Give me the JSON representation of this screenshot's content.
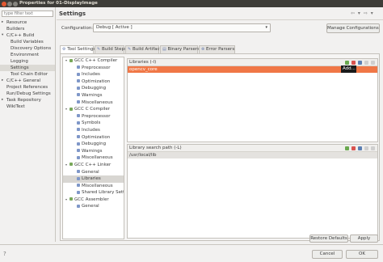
{
  "window": {
    "title": "Properties for 01-DisplayImage"
  },
  "filter": {
    "placeholder": "type filter text"
  },
  "nav": [
    {
      "label": "Resource",
      "arrow": "▸",
      "indent": 0
    },
    {
      "label": "Builders",
      "arrow": "",
      "indent": 0
    },
    {
      "label": "C/C++ Build",
      "arrow": "▾",
      "indent": 0
    },
    {
      "label": "Build Variables",
      "arrow": "",
      "indent": 1
    },
    {
      "label": "Discovery Options",
      "arrow": "",
      "indent": 1
    },
    {
      "label": "Environment",
      "arrow": "",
      "indent": 1
    },
    {
      "label": "Logging",
      "arrow": "",
      "indent": 1
    },
    {
      "label": "Settings",
      "arrow": "",
      "indent": 1,
      "selected": true
    },
    {
      "label": "Tool Chain Editor",
      "arrow": "",
      "indent": 1
    },
    {
      "label": "C/C++ General",
      "arrow": "▸",
      "indent": 0
    },
    {
      "label": "Project References",
      "arrow": "",
      "indent": 0
    },
    {
      "label": "Run/Debug Settings",
      "arrow": "",
      "indent": 0
    },
    {
      "label": "Task Repository",
      "arrow": "▸",
      "indent": 0
    },
    {
      "label": "WikiText",
      "arrow": "",
      "indent": 0
    }
  ],
  "header": {
    "title": "Settings",
    "nav_arrows": "⇦ ▾ ⇨ ▾"
  },
  "configuration": {
    "label": "Configuration:",
    "value": "Debug  [ Active ]",
    "manage_label": "Manage Configurations..."
  },
  "tabs": [
    {
      "label": "Tool Settings",
      "icon": "gear-icon",
      "active": true
    },
    {
      "label": "Build Steps",
      "icon": "build-steps-icon"
    },
    {
      "label": "Build Artifact",
      "icon": "artifact-icon"
    },
    {
      "label": "Binary Parsers",
      "icon": "binary-parser-icon"
    },
    {
      "label": "Error Parsers",
      "icon": "error-parser-icon"
    }
  ],
  "tree": [
    {
      "label": "GCC C++ Compiler",
      "level": 0,
      "arrow": "▾"
    },
    {
      "label": "Preprocessor",
      "level": 1
    },
    {
      "label": "Includes",
      "level": 1
    },
    {
      "label": "Optimization",
      "level": 1
    },
    {
      "label": "Debugging",
      "level": 1
    },
    {
      "label": "Warnings",
      "level": 1
    },
    {
      "label": "Miscellaneous",
      "level": 1
    },
    {
      "label": "GCC C Compiler",
      "level": 0,
      "arrow": "▾"
    },
    {
      "label": "Preprocessor",
      "level": 1
    },
    {
      "label": "Symbols",
      "level": 1
    },
    {
      "label": "Includes",
      "level": 1
    },
    {
      "label": "Optimization",
      "level": 1
    },
    {
      "label": "Debugging",
      "level": 1
    },
    {
      "label": "Warnings",
      "level": 1
    },
    {
      "label": "Miscellaneous",
      "level": 1
    },
    {
      "label": "GCC C++ Linker",
      "level": 0,
      "arrow": "▾"
    },
    {
      "label": "General",
      "level": 1
    },
    {
      "label": "Libraries",
      "level": 1,
      "selected": true
    },
    {
      "label": "Miscellaneous",
      "level": 1
    },
    {
      "label": "Shared Library Settings",
      "level": 1
    },
    {
      "label": "GCC Assembler",
      "level": 0,
      "arrow": "▾"
    },
    {
      "label": "General",
      "level": 1
    }
  ],
  "libraries": {
    "title": "Libraries (-l)",
    "items": [
      "opencv_core"
    ],
    "tooltip": "Add..."
  },
  "search_path": {
    "title": "Library search path (-L)",
    "items": [
      "/usr/local/lib"
    ]
  },
  "buttons": {
    "restore": "Restore Defaults",
    "apply": "Apply",
    "cancel": "Cancel",
    "ok": "OK",
    "help": "?"
  },
  "colors": {
    "selection": "#f07746",
    "titlebar": "#3e3d39"
  }
}
